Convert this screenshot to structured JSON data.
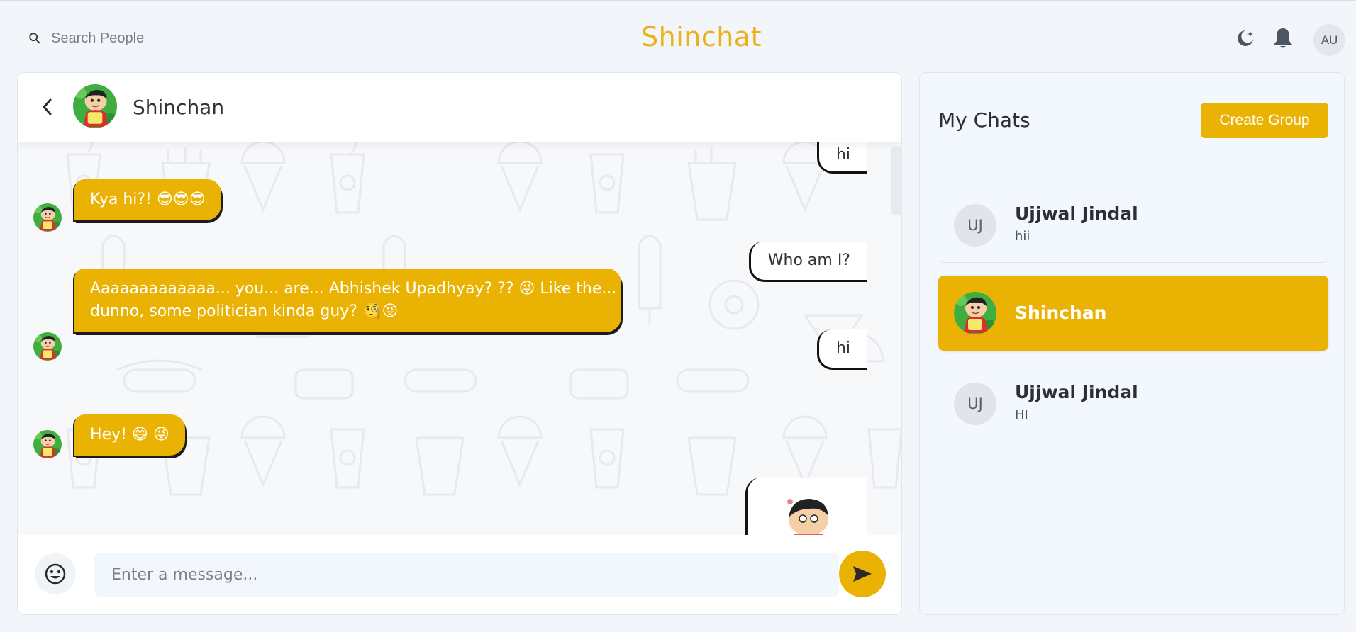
{
  "header": {
    "search_label": "Search People",
    "brand": "Shinchat",
    "avatar_initials": "AU"
  },
  "chat": {
    "name": "Shinchan",
    "messages": [
      {
        "side": "out",
        "text": "hi"
      },
      {
        "side": "in",
        "text": "Kya hi?! 😎😎😎"
      },
      {
        "side": "out",
        "text": "Who am I?"
      },
      {
        "side": "in",
        "line1": "Aaaaaaaaaaaaa... you... are... Abhishek Upadhyay? ?? 😜 Like the...",
        "line2": "dunno, some politician kinda guy? 🧐😜"
      },
      {
        "side": "out",
        "text": "hi"
      },
      {
        "side": "in",
        "text": "Hey! 😄 😜"
      }
    ],
    "input_placeholder": "Enter a message..."
  },
  "sidebar": {
    "title": "My Chats",
    "create_group_label": "Create Group",
    "items": [
      {
        "initials": "UJ",
        "name": "Ujjwal Jindal",
        "last_message": "hii",
        "active": false
      },
      {
        "initials": "",
        "name": "Shinchan",
        "last_message": "",
        "active": true
      },
      {
        "initials": "UJ",
        "name": "Ujjwal Jindal",
        "last_message": "HI",
        "active": false
      }
    ]
  },
  "colors": {
    "accent": "#eab203",
    "brand": "#eab118",
    "panel_bg": "#f3f8fc"
  }
}
